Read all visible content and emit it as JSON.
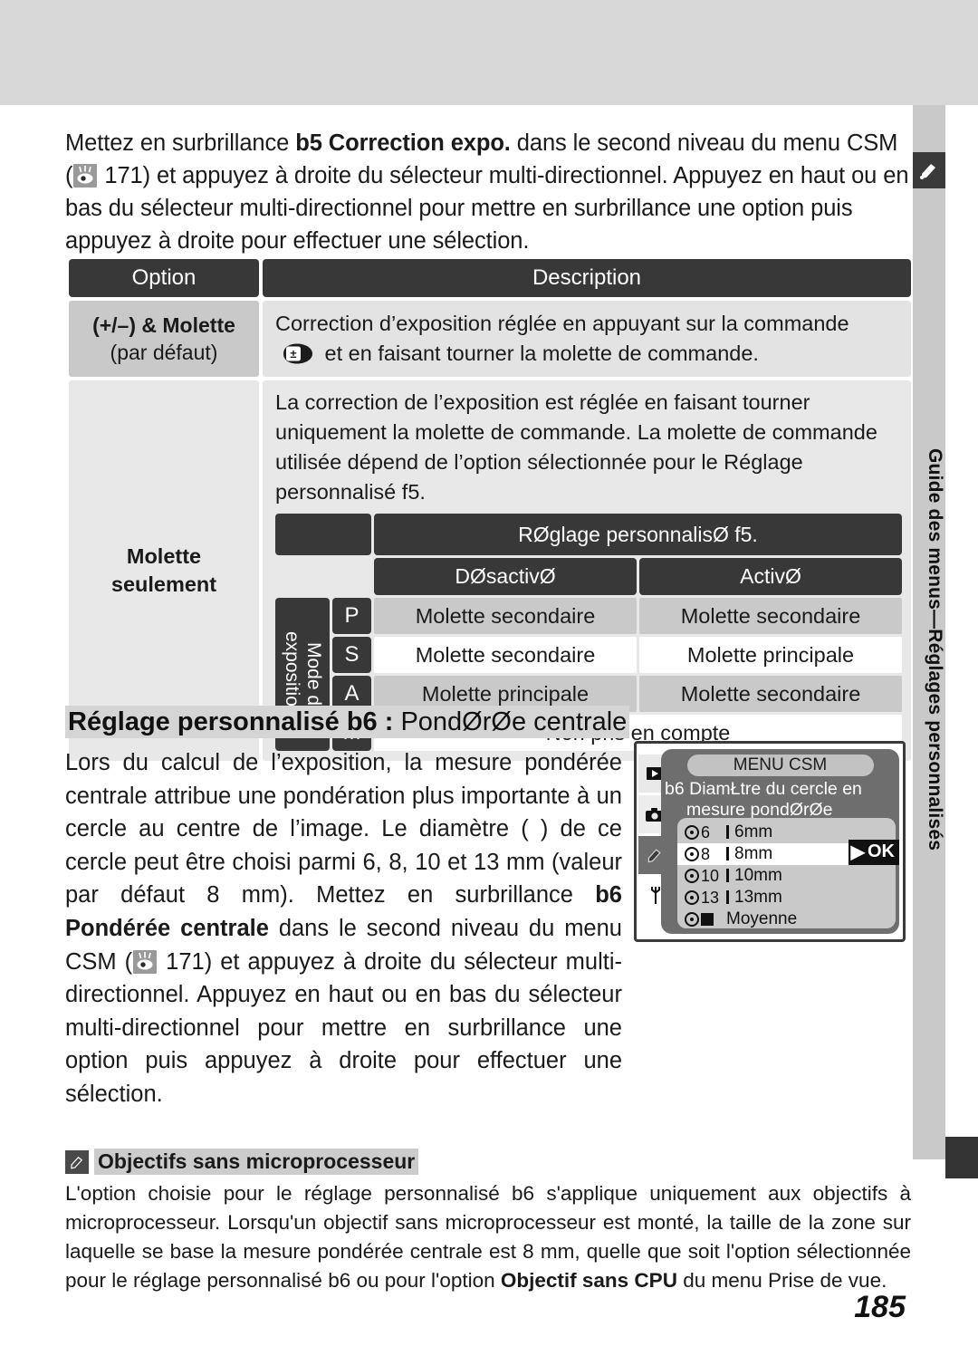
{
  "sidebar": {
    "label": "Guide des menus—Réglages personnalisés",
    "icon": "pencil-icon"
  },
  "intro": {
    "part1": "Mettez en surbrillance ",
    "bold1": "b5 Correction expo.",
    "part2": " dans le second niveau du menu CSM (",
    "ref_icon": "eye-reference-icon",
    "page_ref": " 171) et appuyez à droite du sélecteur multi-directionnel. Appuyez en haut ou en bas du sélecteur multi-directionnel pour mettre en surbrillance une option puis appuyez à droite pour effectuer une sélection."
  },
  "table": {
    "headers": {
      "option": "Option",
      "description": "Description"
    },
    "row1": {
      "option_bold": "(+/–) & Molette",
      "option_sub": "(par défaut)",
      "desc_a": "Correction d’exposition réglée en appuyant sur la commande ",
      "desc_icon": "exposure-compensation-button-icon",
      "desc_b": " et en faisant tourner la molette de commande."
    },
    "row2": {
      "option": "Molette seulement",
      "desc": "La correction de l’exposition est réglée en faisant tourner uniquement la molette de commande. La molette de commande utilisée dépend de l’option sélectionnée pour le Réglage personnalisé f5.",
      "subtable": {
        "title": "RØglage personnalisØ f5.",
        "col_left": "DØsactivØ",
        "col_right": "ActivØ",
        "side_label": "Mode d exposition",
        "rows": [
          {
            "mode": "P",
            "left": "Molette secondaire",
            "right": "Molette secondaire"
          },
          {
            "mode": "S",
            "left": "Molette secondaire",
            "right": "Molette principale"
          },
          {
            "mode": "A",
            "left": "Molette principale",
            "right": "Molette secondaire"
          },
          {
            "mode": "M",
            "span": "Non pris en compte"
          }
        ]
      }
    }
  },
  "section": {
    "heading_bold": "Réglage personnalisé b6 :",
    "heading_rest": " PondØrØe centrale",
    "body_a": "Lors du calcul de l’exposition, la mesure pondérée centrale attribue une pondération plus importante à un cercle au centre de l’image. Le diamètre ( ) de ce cercle peut être choisi parmi 6, 8, 10 et 13 mm (valeur par défaut 8 mm). Mettez en surbrillance ",
    "body_bold1": "b6 Pondérée centrale",
    "body_b": " dans le second niveau du menu CSM (",
    "body_c": " 171) et appuyez à droite du sélecteur multi-directionnel. Appuyez en haut ou en bas du sélecteur multi-directionnel pour mettre en surbrillance une option puis appuyez à droite pour effectuer une sélection."
  },
  "lcd": {
    "title": "MENU CSM",
    "item_code": "b6",
    "subtitle_line1": "DiamŁtre du cercle en",
    "subtitle_line2": "mesure pondØrØe centrale",
    "ok_label": "OK",
    "ok_arrow": "▶",
    "tabs": [
      "playback-icon",
      "camera-icon",
      "pencil-icon",
      "wrench-icon"
    ],
    "items": [
      {
        "num": "6",
        "label": "6mm",
        "selected": false
      },
      {
        "num": "8",
        "label": "8mm",
        "selected": true
      },
      {
        "num": "10",
        "label": "10mm",
        "selected": false
      },
      {
        "num": "13",
        "label": "13mm",
        "selected": false
      },
      {
        "num": "",
        "label": "Moyenne",
        "selected": false,
        "square": true
      }
    ]
  },
  "note": {
    "icon": "pencil-icon",
    "title": "Objectifs sans microprocesseur",
    "body_a": "L'option choisie pour le réglage personnalisé b6 s'applique uniquement aux objectifs à microprocesseur. Lorsqu'un objectif sans microprocesseur est monté, la taille de la zone sur laquelle se base la mesure pondérée centrale est 8 mm, quelle que soit l'option sélectionnée pour le réglage personnalisé b6 ou pour l'option ",
    "body_bold": "Objectif sans CPU",
    "body_b": " du menu Prise de vue."
  },
  "page_number": "185",
  "colors": {
    "dark": "#383838",
    "shade": "#c9c9c9",
    "light": "#e8e8e8",
    "band": "#d8d8d8"
  }
}
